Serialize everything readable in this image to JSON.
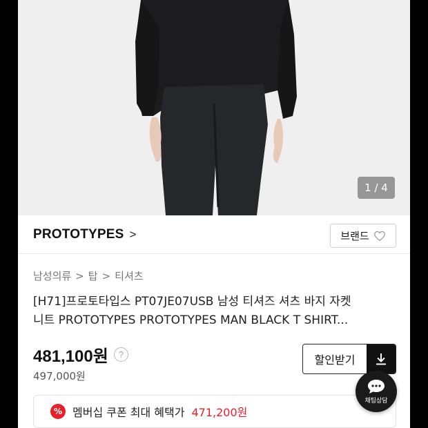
{
  "gallery": {
    "counter": "1 / 4"
  },
  "brand": {
    "name": "PROTOTYPES",
    "chevron": ">",
    "button_label": "브랜드",
    "heart_icon": "heart-outline-icon"
  },
  "breadcrumb": {
    "items": [
      "남성의류",
      "탑",
      "티셔츠"
    ],
    "separator": ">"
  },
  "product": {
    "title_line1": "[H71]프로토타입스 PT07JE07USB 남성 티셔즈 셔츠 바지 자켓",
    "title_line2": "니트 PROTOTYPES PROTOTYPES MAN BLACK T SHIRT..."
  },
  "price": {
    "sale": "481,100원",
    "help": "?",
    "original": "497,000원"
  },
  "coupon": {
    "label": "할인받기",
    "icon": "download-icon"
  },
  "chat": {
    "label": "채팅상담",
    "icon": "chat-bubble-icon"
  },
  "membership": {
    "badge": "%",
    "text": "멤버십 쿠폰 최대 혜택가",
    "amount": "471,200원"
  },
  "colors": {
    "accent": "#e8202a",
    "dark": "#111111"
  }
}
